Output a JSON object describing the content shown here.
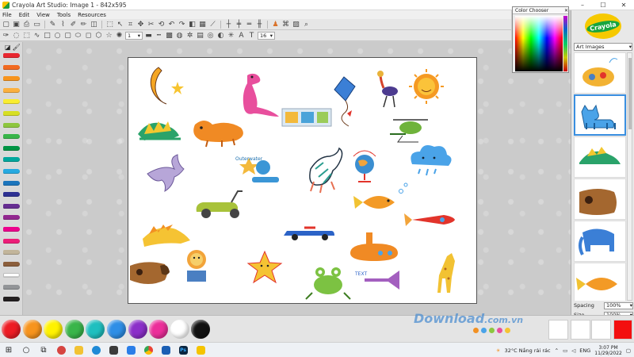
{
  "window": {
    "title": "Crayola Art Studio: Image 1 - 842x595",
    "controls": [
      "–",
      "☐",
      "✕"
    ]
  },
  "menu": [
    "File",
    "Edit",
    "View",
    "Tools",
    "Resources"
  ],
  "toolbar2": {
    "brush_size": "1",
    "font_size": "16"
  },
  "color_chooser": {
    "title": "Color Chooser",
    "close": "✕"
  },
  "right_panel": {
    "logo": "Crayola",
    "category": "Art Images",
    "spacing_label": "Spacing",
    "spacing_value": "100%",
    "size_label": "Size",
    "size_value": "100%"
  },
  "canvas_text": {
    "badge": "Outerwater",
    "banner": "TEXT"
  },
  "colors": {
    "crayons": [
      "#e8262f",
      "#f26a21",
      "#f7941d",
      "#fbb040",
      "#f9ed32",
      "#d7df23",
      "#8dc63f",
      "#39b54a",
      "#009444",
      "#00a79d",
      "#27aae1",
      "#1c75bc",
      "#2e3192",
      "#662d91",
      "#92278f",
      "#ec008c",
      "#ed1e79",
      "#c2b59b",
      "#8b5e3c",
      "#ffffff",
      "#939598",
      "#231f20"
    ],
    "paints": [
      "#ed1c24",
      "#f7941d",
      "#fff200",
      "#39b54a",
      "#1fbfbf",
      "#2e8ee6",
      "#8b2fc9",
      "#ec2e9a",
      "#ffffff",
      "#111111"
    ],
    "current": "#f30f0f"
  },
  "watermark": {
    "main": "Download",
    "suffix": ".com.vn"
  },
  "taskbar": {
    "weather": "32°C  Nắng rải rác",
    "language": "ENG",
    "time": "3:07 PM",
    "date": "11/29/2022"
  }
}
